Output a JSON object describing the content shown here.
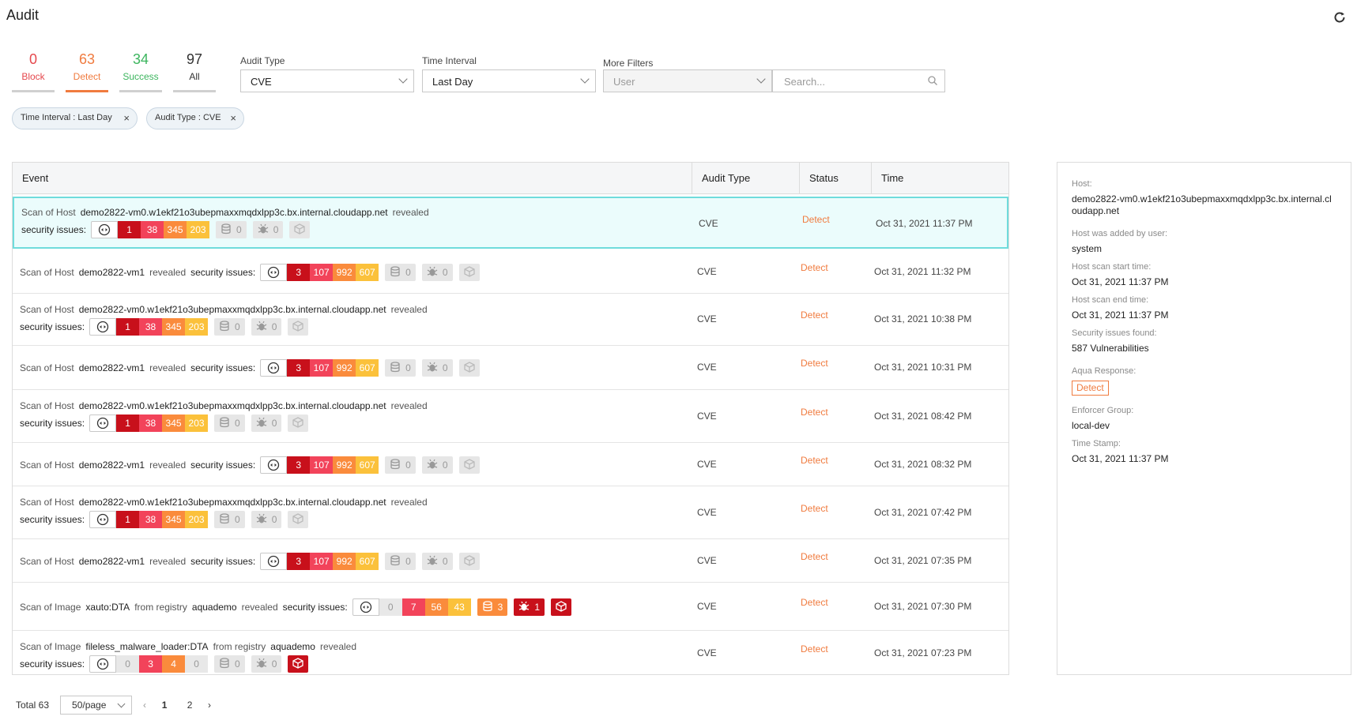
{
  "page": {
    "title": "Audit"
  },
  "counters": [
    {
      "value": "0",
      "label": "Block"
    },
    {
      "value": "63",
      "label": "Detect"
    },
    {
      "value": "34",
      "label": "Success"
    },
    {
      "value": "97",
      "label": "All"
    }
  ],
  "filters": {
    "audit_type_label": "Audit Type",
    "audit_type_value": "CVE",
    "time_interval_label": "Time Interval",
    "time_interval_value": "Last Day",
    "more_filters_label": "More Filters",
    "more_filters_value": "User",
    "search_placeholder": "Search..."
  },
  "chips": [
    {
      "label": "Time Interval : Last Day"
    },
    {
      "label": "Audit Type : CVE"
    }
  ],
  "table": {
    "columns": [
      "Event",
      "Audit Type",
      "Status",
      "Time"
    ],
    "rows": [
      {
        "prefix": "Scan of Host",
        "target": "demo2822-vm0.w1ekf21o3ubepmaxxmqdxlpp3c.bx.internal.cloudapp.net",
        "mid": "",
        "mid_target": "",
        "suffix": "revealed",
        "issues": "security issues:",
        "crit": "1",
        "high": "38",
        "med": "345",
        "low": "203",
        "db": "0",
        "bug": "0",
        "type": "CVE",
        "status": "Detect",
        "time": "Oct 31, 2021 11:37 PM"
      },
      {
        "prefix": "Scan of Host",
        "target": "demo2822-vm1",
        "mid": "",
        "mid_target": "",
        "suffix": "revealed",
        "issues": "security issues:",
        "crit": "3",
        "high": "107",
        "med": "992",
        "low": "607",
        "db": "0",
        "bug": "0",
        "type": "CVE",
        "status": "Detect",
        "time": "Oct 31, 2021 11:32 PM"
      },
      {
        "prefix": "Scan of Host",
        "target": "demo2822-vm0.w1ekf21o3ubepmaxxmqdxlpp3c.bx.internal.cloudapp.net",
        "mid": "",
        "mid_target": "",
        "suffix": "revealed",
        "issues": "security issues:",
        "crit": "1",
        "high": "38",
        "med": "345",
        "low": "203",
        "db": "0",
        "bug": "0",
        "type": "CVE",
        "status": "Detect",
        "time": "Oct 31, 2021 10:38 PM"
      },
      {
        "prefix": "Scan of Host",
        "target": "demo2822-vm1",
        "mid": "",
        "mid_target": "",
        "suffix": "revealed",
        "issues": "security issues:",
        "crit": "3",
        "high": "107",
        "med": "992",
        "low": "607",
        "db": "0",
        "bug": "0",
        "type": "CVE",
        "status": "Detect",
        "time": "Oct 31, 2021 10:31 PM"
      },
      {
        "prefix": "Scan of Host",
        "target": "demo2822-vm0.w1ekf21o3ubepmaxxmqdxlpp3c.bx.internal.cloudapp.net",
        "mid": "",
        "mid_target": "",
        "suffix": "revealed",
        "issues": "security issues:",
        "crit": "1",
        "high": "38",
        "med": "345",
        "low": "203",
        "db": "0",
        "bug": "0",
        "type": "CVE",
        "status": "Detect",
        "time": "Oct 31, 2021 08:42 PM"
      },
      {
        "prefix": "Scan of Host",
        "target": "demo2822-vm1",
        "mid": "",
        "mid_target": "",
        "suffix": "revealed",
        "issues": "security issues:",
        "crit": "3",
        "high": "107",
        "med": "992",
        "low": "607",
        "db": "0",
        "bug": "0",
        "type": "CVE",
        "status": "Detect",
        "time": "Oct 31, 2021 08:32 PM"
      },
      {
        "prefix": "Scan of Host",
        "target": "demo2822-vm0.w1ekf21o3ubepmaxxmqdxlpp3c.bx.internal.cloudapp.net",
        "mid": "",
        "mid_target": "",
        "suffix": "revealed",
        "issues": "security issues:",
        "crit": "1",
        "high": "38",
        "med": "345",
        "low": "203",
        "db": "0",
        "bug": "0",
        "type": "CVE",
        "status": "Detect",
        "time": "Oct 31, 2021 07:42 PM"
      },
      {
        "prefix": "Scan of Host",
        "target": "demo2822-vm1",
        "mid": "",
        "mid_target": "",
        "suffix": "revealed",
        "issues": "security issues:",
        "crit": "3",
        "high": "107",
        "med": "992",
        "low": "607",
        "db": "0",
        "bug": "0",
        "type": "CVE",
        "status": "Detect",
        "time": "Oct 31, 2021 07:35 PM"
      },
      {
        "prefix": "Scan of Image",
        "target": "xauto:DTA",
        "mid": "from registry",
        "mid_target": "aquademo",
        "suffix": "revealed",
        "issues": "security issues:",
        "crit": "0",
        "high": "7",
        "med": "56",
        "low": "43",
        "db": "3",
        "bug": "1",
        "type": "CVE",
        "status": "Detect",
        "time": "Oct 31, 2021 07:30 PM"
      },
      {
        "prefix": "Scan of Image",
        "target": "fileless_malware_loader:DTA",
        "mid": "from registry",
        "mid_target": "aquademo",
        "suffix": "revealed",
        "issues": "security issues:",
        "crit": "0",
        "high": "3",
        "med": "4",
        "low": "0",
        "db": "0",
        "bug": "0",
        "type": "CVE",
        "status": "Detect",
        "time": "Oct 31, 2021 07:23 PM"
      }
    ]
  },
  "detail": {
    "host_label": "Host:",
    "host_value": "demo2822-vm0.w1ekf21o3ubepmaxxmqdxlpp3c.bx.internal.cloudapp.net",
    "added_label": "Host was added by user:",
    "added_value": "system",
    "start_label": "Host scan start time:",
    "start_value": "Oct 31, 2021 11:37 PM",
    "end_label": "Host scan end time:",
    "end_value": "Oct 31, 2021 11:37 PM",
    "issues_label": "Security issues found:",
    "issues_value": "587 Vulnerabilities",
    "response_label": "Aqua Response:",
    "response_value": "Detect",
    "group_label": "Enforcer Group:",
    "group_value": "local-dev",
    "timestamp_label": "Time Stamp:",
    "timestamp_value": "Oct 31, 2021 11:37 PM"
  },
  "pager": {
    "total": "Total 63",
    "page_size": "50/page",
    "pages": [
      "1",
      "2"
    ]
  },
  "colors": {
    "critical": "#c8101b",
    "high": "#f2435a",
    "medium": "#fa8b3c",
    "low": "#fbc13b",
    "detect": "#f07b3f",
    "selected_row": "#ebfcfc"
  },
  "icons": {
    "refresh": "refresh-icon",
    "search": "search-icon",
    "close": "close-icon",
    "vulnerability": "vulnerability-icon",
    "database": "database-icon",
    "bug": "bug-icon",
    "package": "package-icon"
  }
}
